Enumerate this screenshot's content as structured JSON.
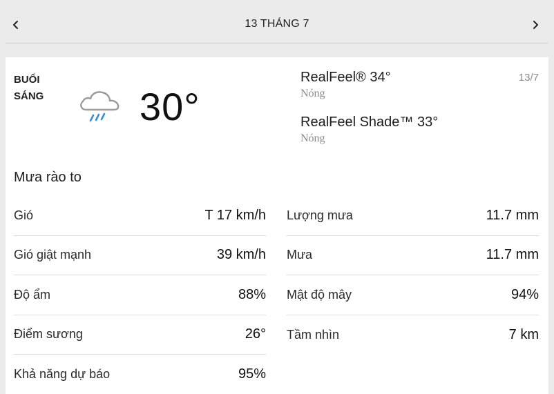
{
  "header": {
    "date": "13 THÁNG 7",
    "prev_icon": "chevron-left-icon",
    "next_icon": "chevron-right-icon"
  },
  "current": {
    "period": "BUỔI SÁNG",
    "period_line1": "BUỔI",
    "period_line2": "SÁNG",
    "icon": "rain-cloud-icon",
    "temperature": "30°",
    "short_date": "13/7",
    "realfeel": "RealFeel® 34°",
    "realfeel_phrase": "Nóng",
    "realfeel_shade": "RealFeel Shade™ 33°",
    "realfeel_shade_phrase": "Nóng",
    "description": "Mưa rào to"
  },
  "details_left": [
    {
      "label": "Gió",
      "value": "T 17 km/h"
    },
    {
      "label": "Gió giật mạnh",
      "value": "39 km/h"
    },
    {
      "label": "Độ ẩm",
      "value": "88%"
    },
    {
      "label": "Điểm sương",
      "value": "26°"
    },
    {
      "label": "Khả năng dự báo",
      "value": "95%"
    }
  ],
  "details_right": [
    {
      "label": "Lượng mưa",
      "value": "11.7 mm"
    },
    {
      "label": "Mưa",
      "value": "11.7 mm"
    },
    {
      "label": "Mật độ mây",
      "value": "94%"
    },
    {
      "label": "Tầm nhìn",
      "value": "7 km"
    }
  ],
  "colors": {
    "background": "#ebebeb",
    "card": "#ffffff",
    "muted_text": "#8a8a8a",
    "rain": "#3a8fd1",
    "cloud_stroke": "#9a9a9a"
  }
}
